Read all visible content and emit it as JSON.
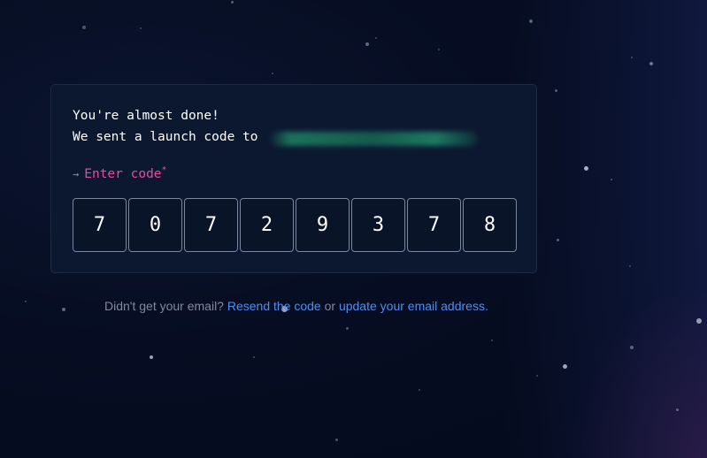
{
  "message": {
    "title": "You're almost done!",
    "sent_text": "We sent a launch code to"
  },
  "code_entry": {
    "arrow_icon": "→",
    "label": "Enter code",
    "required_mark": "*",
    "digits": [
      "7",
      "0",
      "7",
      "2",
      "9",
      "3",
      "7",
      "8"
    ]
  },
  "footer": {
    "prompt": "Didn't get your email?",
    "resend_link": "Resend the code",
    "or_text": "or",
    "update_link": "update your email address."
  },
  "colors": {
    "accent_pink": "#e14da0",
    "link_blue": "#4f8df0",
    "card_bg": "#0c1830",
    "page_bg": "#060d22"
  }
}
